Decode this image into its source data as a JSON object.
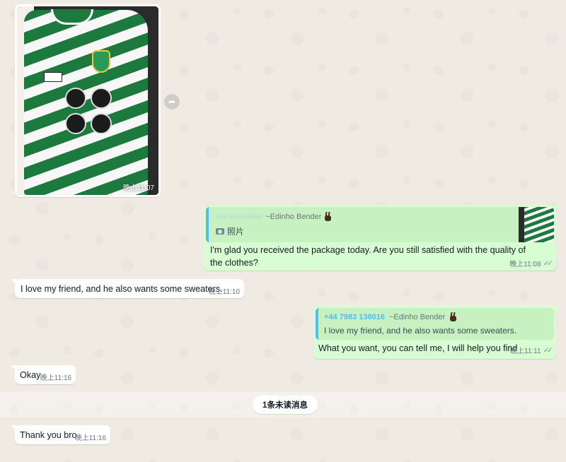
{
  "photo_message": {
    "time": "晚上11:07",
    "forward_icon": "forward-arrow-icon"
  },
  "outgoing_1": {
    "quote": {
      "sender_blurred": "+•• •••• ••••••",
      "sender_name": "~Edinho Bender",
      "media_label": "照片",
      "media_icon": "camera-icon"
    },
    "text": "I'm glad you received the package today. Are you still satisfied with the quality of the clothes?",
    "time": "晚上11:08",
    "status": "✓✓"
  },
  "incoming_1": {
    "text": "I love my friend, and he also wants some sweaters.",
    "time": "晚上11:10"
  },
  "outgoing_2": {
    "quote": {
      "sender_phone": "+44 7983 138016",
      "sender_name": "~Edinho Bender",
      "text": "I love my friend, and he also wants some sweaters."
    },
    "text": "What you want, you can tell me, I will help you find",
    "time": "晚上11:11",
    "status": "✓✓"
  },
  "incoming_2": {
    "text": "Okay",
    "time": "晚上11:16"
  },
  "unread_divider": {
    "label": "1条未读消息"
  },
  "incoming_3": {
    "text": "Thank you bro",
    "time": "晚上11:16"
  },
  "colors": {
    "chat_background": "#efeae2",
    "incoming_bubble": "#ffffff",
    "outgoing_bubble": "#d9fdd3",
    "quote_accent": "#53bdeb"
  }
}
